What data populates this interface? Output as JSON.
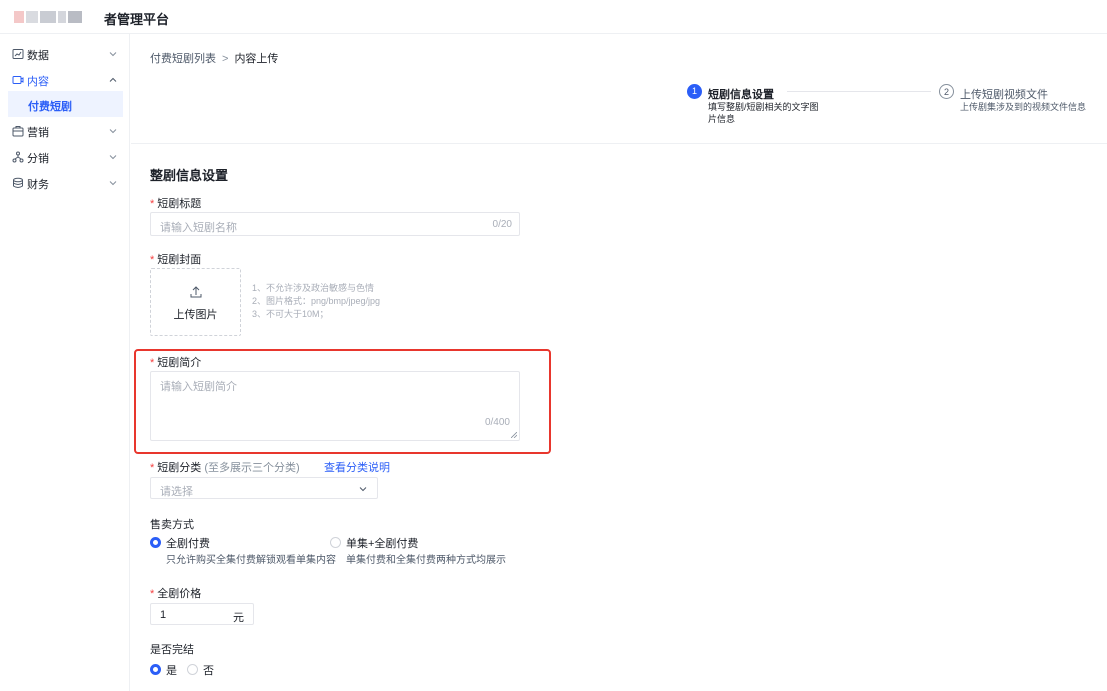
{
  "header": {
    "title": "者管理平台",
    "logo_colors": [
      "#f4c8c8",
      "#ffffff",
      "#d9dbe0",
      "#ffffff",
      "#c9ccd3",
      "#ffffff",
      "#d4d6dc",
      "#ffffff",
      "#b9bcc4"
    ]
  },
  "sidebar": {
    "items": [
      {
        "label": "数据",
        "icon": "dashboard-icon",
        "expanded": false
      },
      {
        "label": "内容",
        "icon": "content-icon",
        "expanded": true
      },
      {
        "label": "营销",
        "icon": "marketing-icon",
        "expanded": false
      },
      {
        "label": "分销",
        "icon": "distribution-icon",
        "expanded": false
      },
      {
        "label": "财务",
        "icon": "finance-icon",
        "expanded": false
      }
    ],
    "sub_items": [
      {
        "label": "付费短剧",
        "active": true
      }
    ]
  },
  "breadcrumb": {
    "parent": "付费短剧列表",
    "separator": ">",
    "current": "内容上传"
  },
  "steps": [
    {
      "number": "1",
      "title": "短剧信息设置",
      "desc": "填写整剧/短剧相关的文字图片信息",
      "active": true
    },
    {
      "number": "2",
      "title": "上传短剧视频文件",
      "desc": "上传剧集涉及到的视频文件信息",
      "active": false
    }
  ],
  "form": {
    "section_title": "整剧信息设置",
    "title_field": {
      "label": "短剧标题",
      "placeholder": "请输入短剧名称",
      "count": "0/20"
    },
    "cover_field": {
      "label": "短剧封面",
      "upload_label": "上传图片",
      "hints": [
        "1、不允许涉及政治敏感与色情",
        "2、图片格式：png/bmp/jpeg/jpg",
        "3、不可大于10M；"
      ]
    },
    "intro_field": {
      "label": "短剧简介",
      "placeholder": "请输入短剧简介",
      "count": "0/400"
    },
    "category_field": {
      "label": "短剧分类",
      "hint": "(至多展示三个分类)",
      "link": "查看分类说明",
      "placeholder": "请选择"
    },
    "sale_mode": {
      "label": "售卖方式",
      "options": [
        {
          "label": "全剧付费",
          "desc": "只允许购买全集付费解锁观看单集内容",
          "selected": true
        },
        {
          "label": "单集+全剧付费",
          "desc": "单集付费和全集付费两种方式均展示",
          "selected": false
        }
      ]
    },
    "price_field": {
      "label": "全剧价格",
      "value": "1",
      "unit": "元"
    },
    "finished_field": {
      "label": "是否完结",
      "options": [
        {
          "label": "是",
          "selected": true
        },
        {
          "label": "否",
          "selected": false
        }
      ]
    }
  },
  "colors": {
    "primary": "#2b5ef7",
    "required": "#f53f3f",
    "highlight": "#e8362d"
  }
}
